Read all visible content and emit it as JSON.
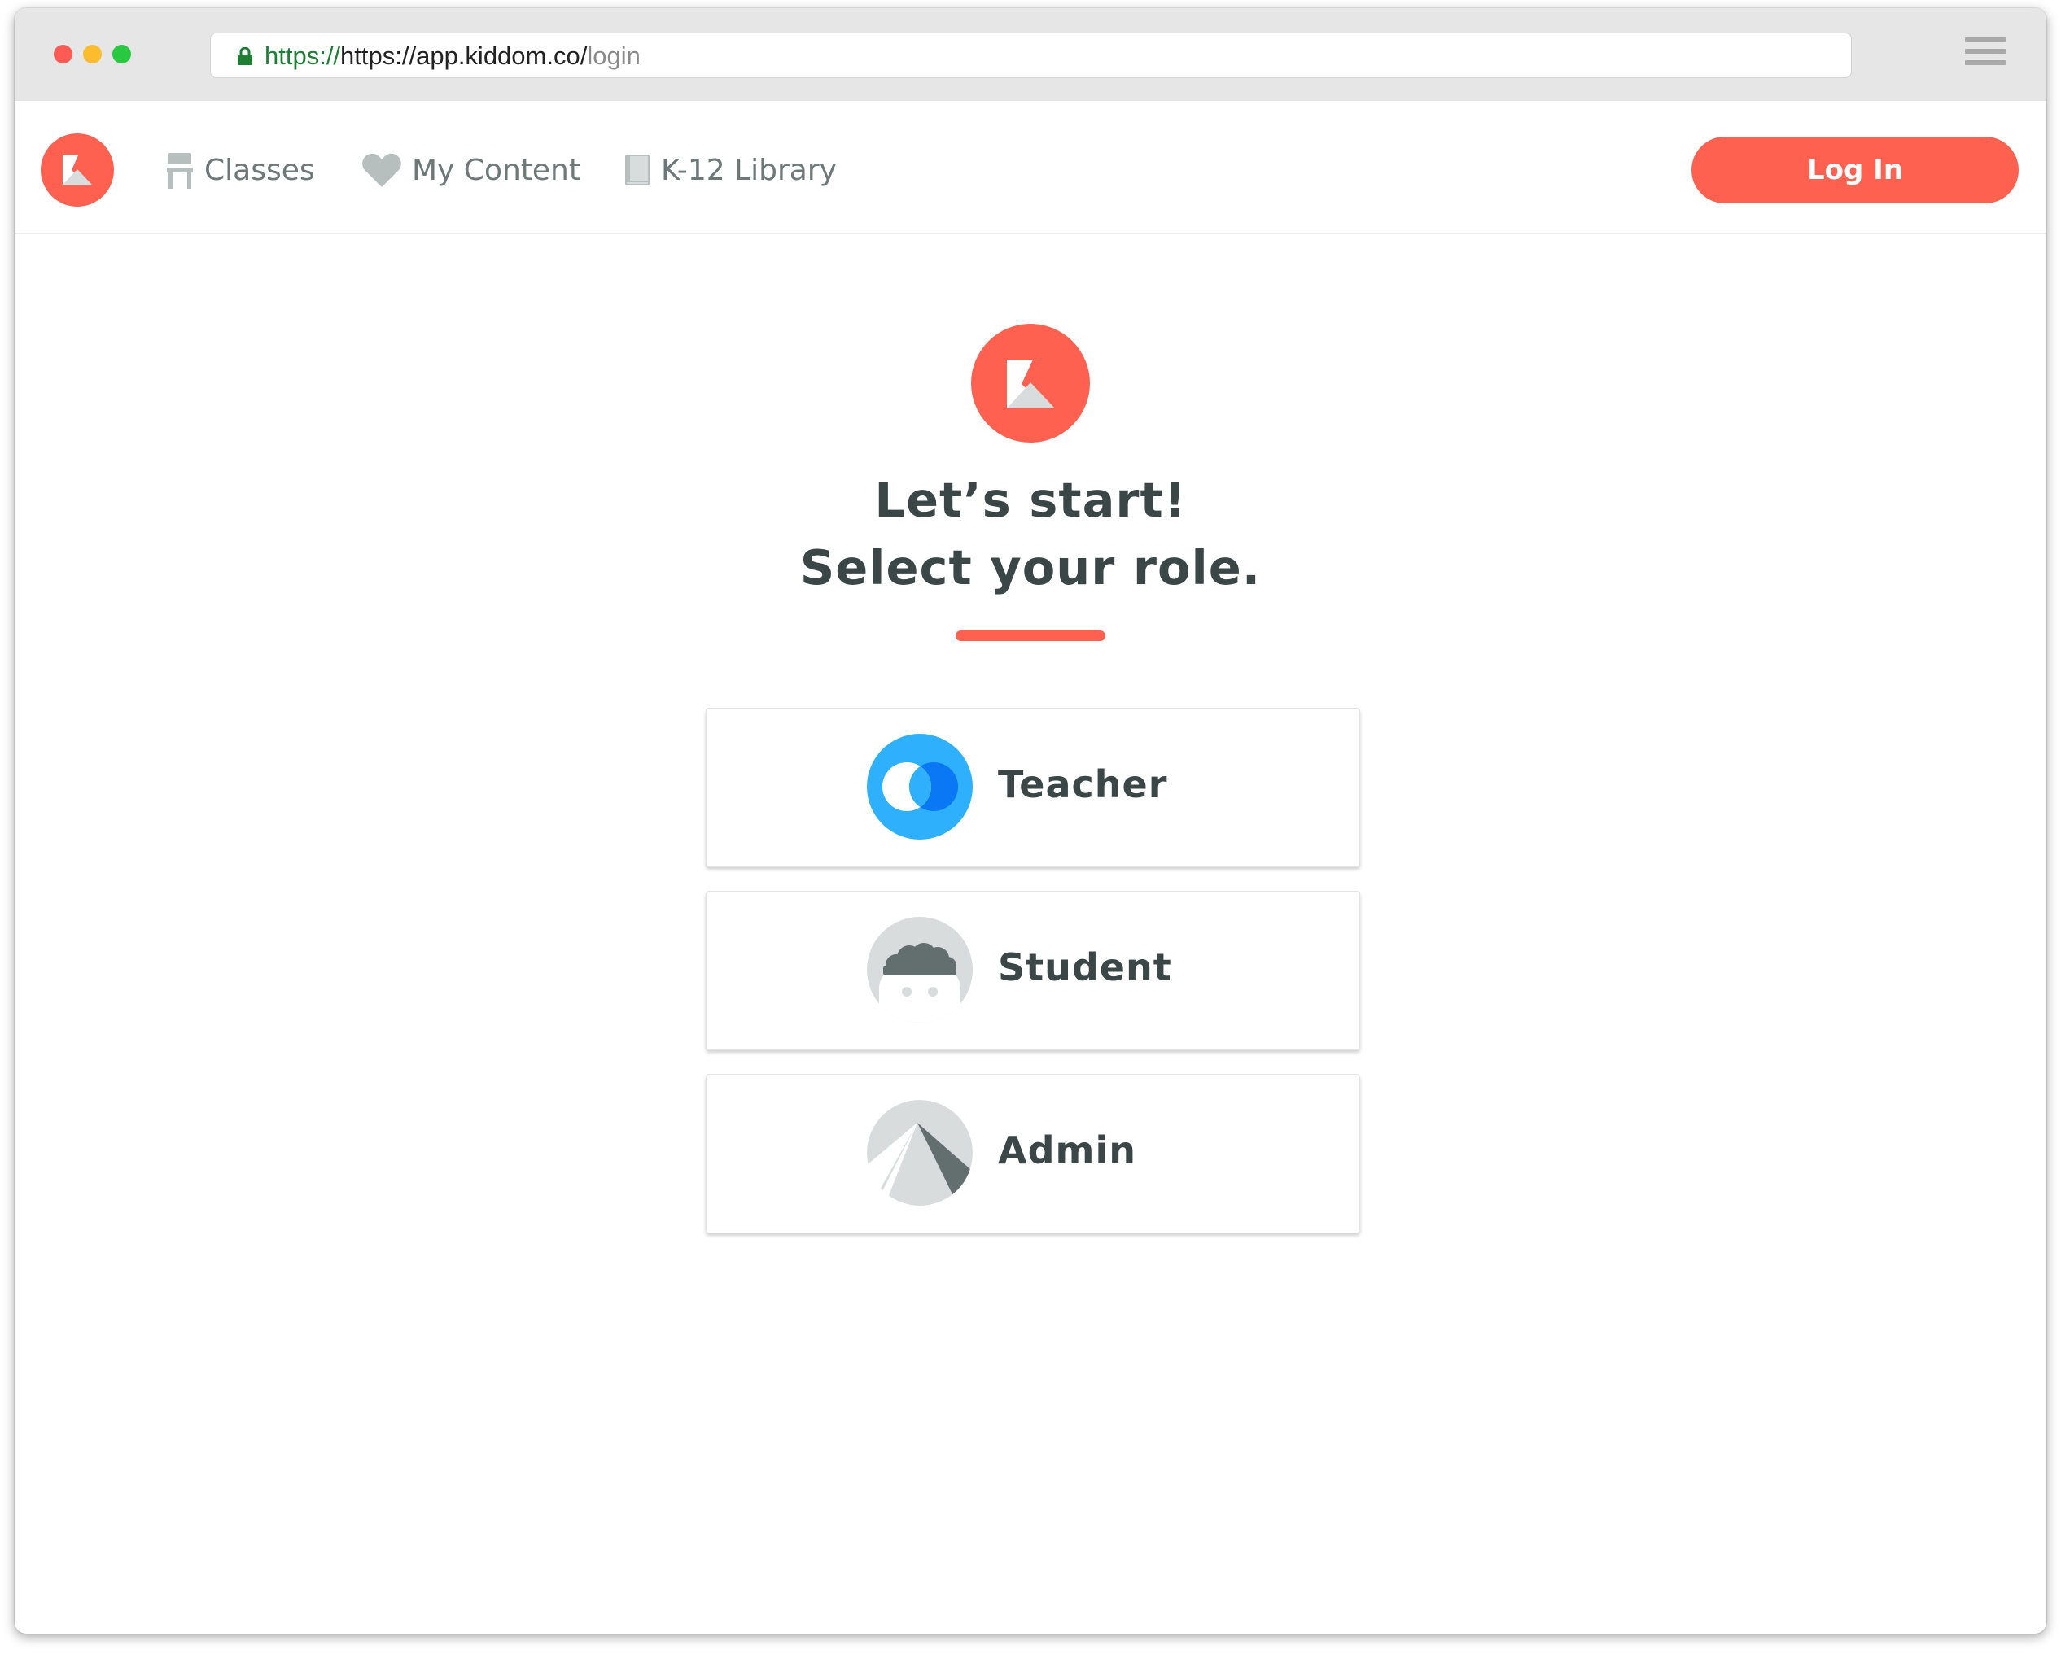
{
  "browser": {
    "url_scheme": "https://",
    "url_host": "https://app.kiddom.co/",
    "url_path": "login",
    "traffic_lights": {
      "close": "#fd5b53",
      "minimize": "#fdbb2e",
      "zoom": "#28c940"
    }
  },
  "nav": {
    "items": [
      {
        "label": "Classes",
        "icon": "chair-icon"
      },
      {
        "label": "My Content",
        "icon": "heart-icon"
      },
      {
        "label": "K-12 Library",
        "icon": "book-icon"
      }
    ],
    "login_label": "Log In"
  },
  "main": {
    "title_line1": "Let’s start!",
    "title_line2": "Select your role.",
    "roles": [
      {
        "label": "Teacher",
        "icon": "teacher-icon"
      },
      {
        "label": "Student",
        "icon": "student-icon"
      },
      {
        "label": "Admin",
        "icon": "admin-icon"
      }
    ]
  },
  "colors": {
    "brand": "#ff6150",
    "text_dark": "#3b4747",
    "nav_text": "#6d7878",
    "teacher_blue": "#2fb0fd",
    "teacher_blue_dark": "#0a77f5",
    "icon_gray": "#d8dcdc",
    "icon_dark": "#636e6e"
  }
}
